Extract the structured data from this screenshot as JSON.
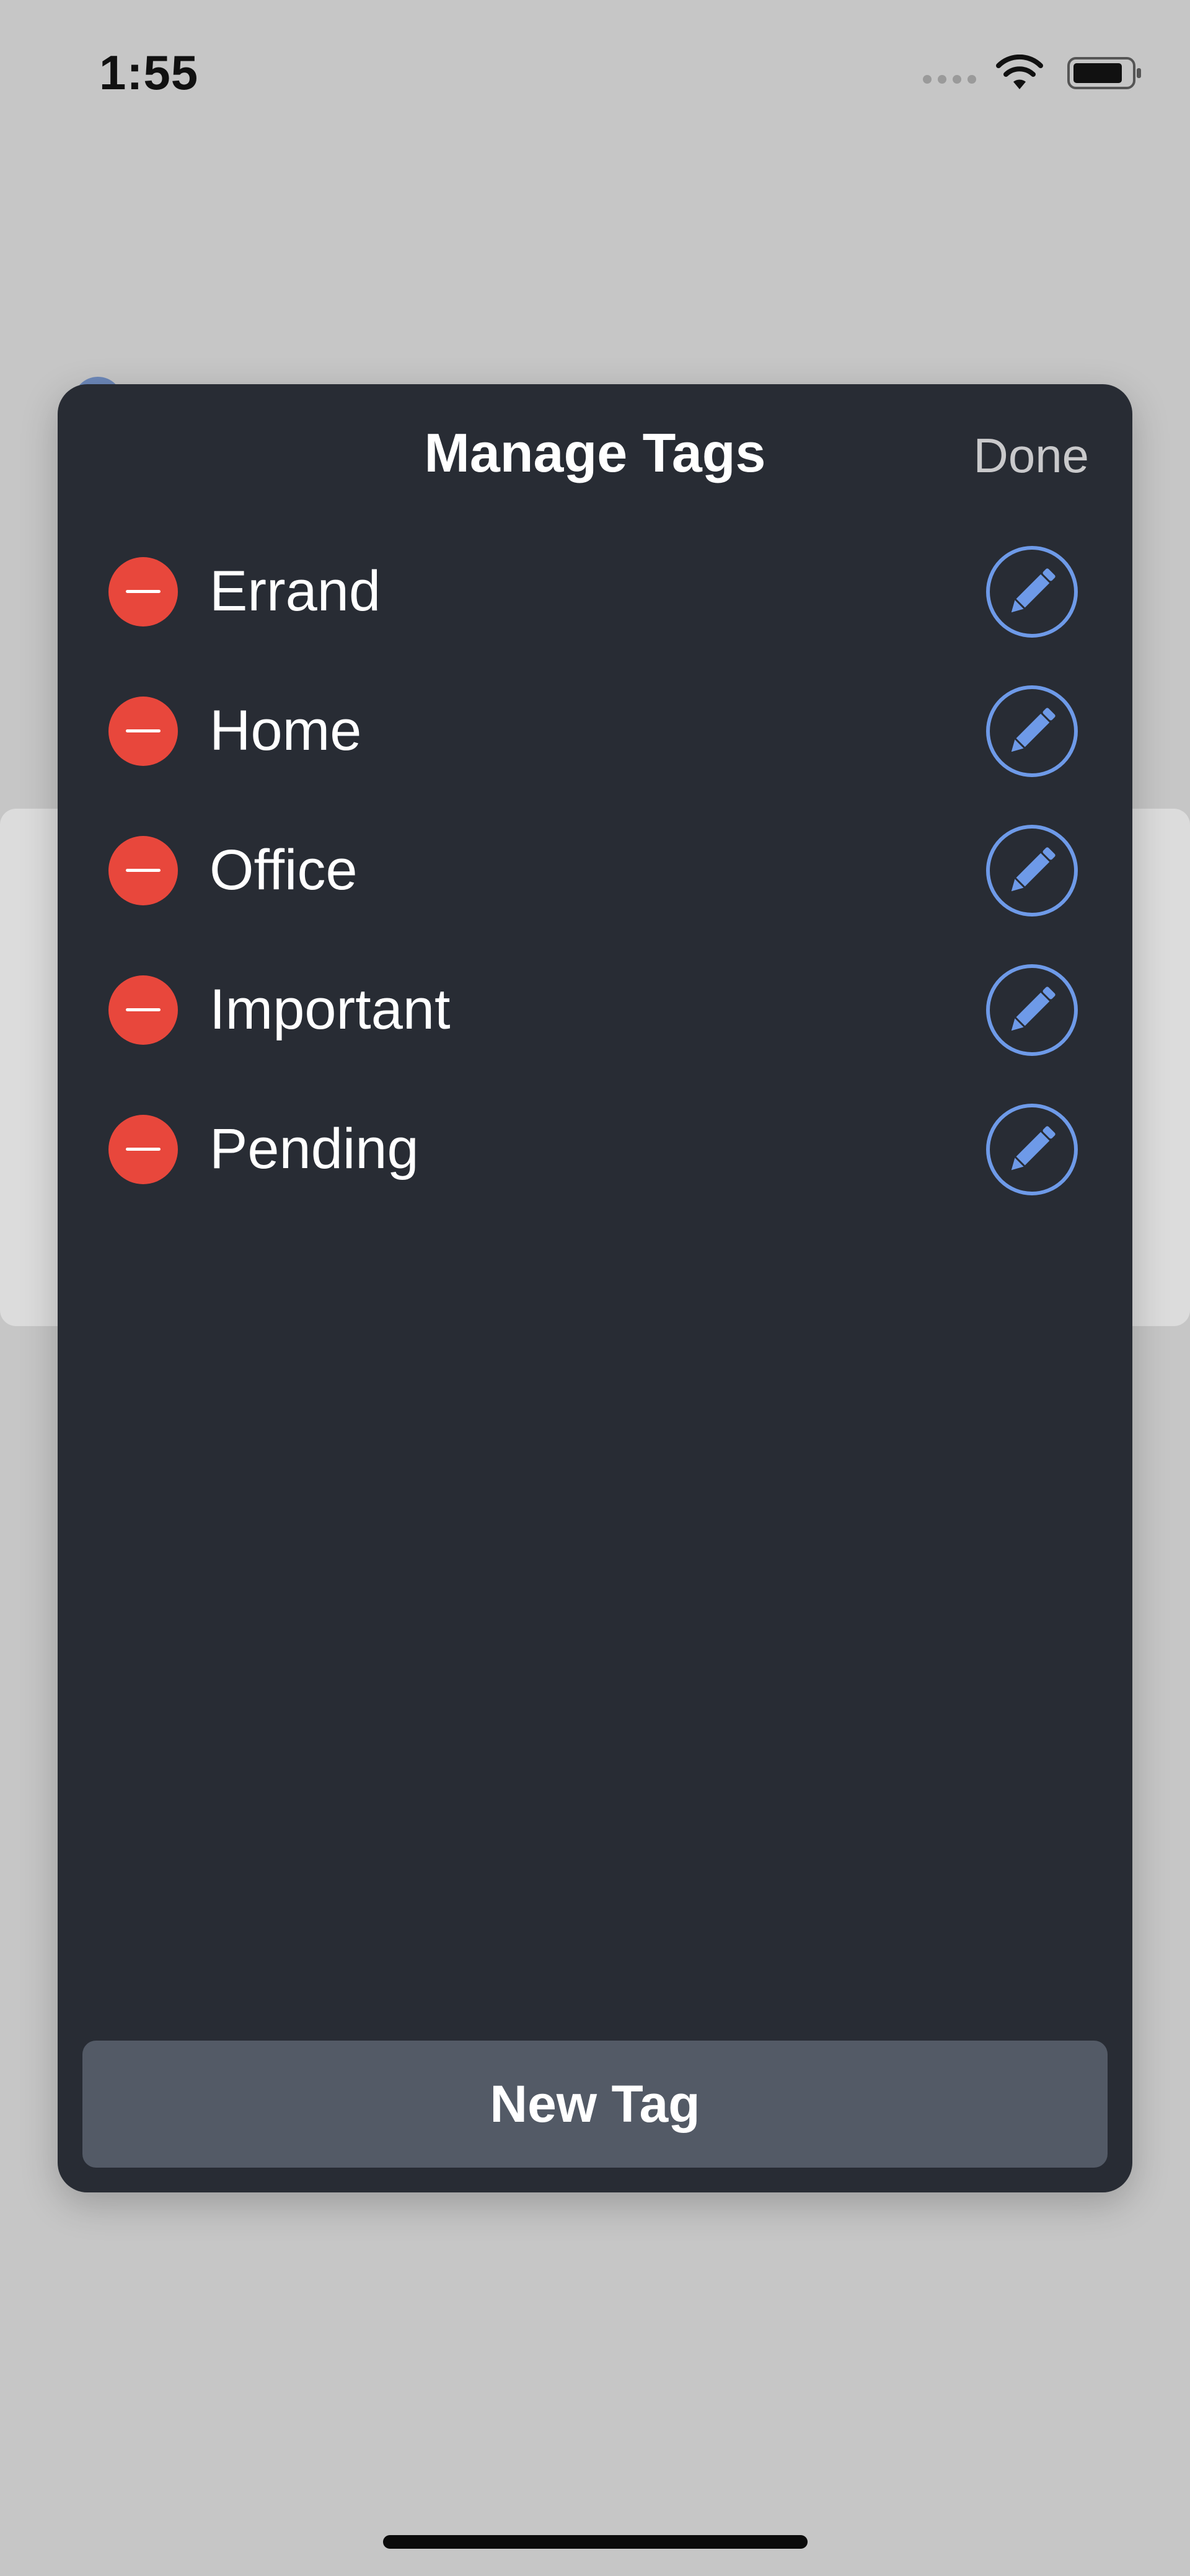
{
  "status_bar": {
    "time": "1:55"
  },
  "sheet": {
    "title": "Manage Tags",
    "done_label": "Done",
    "tags": [
      {
        "label": "Errand"
      },
      {
        "label": "Home"
      },
      {
        "label": "Office"
      },
      {
        "label": "Important"
      },
      {
        "label": "Pending"
      }
    ],
    "new_tag_label": "New Tag"
  },
  "icons": {
    "remove": "minus-circle-icon",
    "edit": "pencil-circle-icon",
    "wifi": "wifi-icon",
    "battery": "battery-icon"
  },
  "colors": {
    "sheet_background": "#282c34",
    "remove_red": "#e8473c",
    "edit_blue": "#6e9ae8",
    "button_gray": "#535a66"
  }
}
